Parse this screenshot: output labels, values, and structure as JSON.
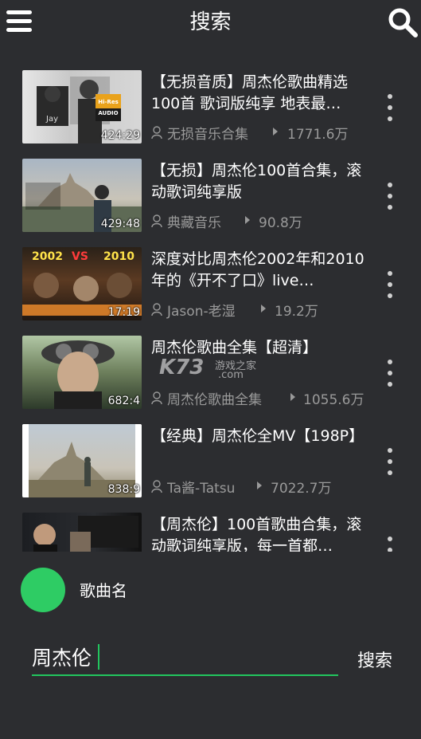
{
  "header": {
    "title": "搜索",
    "menu_icon": "hamburger-menu-icon",
    "search_icon": "search-icon"
  },
  "videos": [
    {
      "title": "【无损音质】周杰伦歌曲精选100首 歌词版纯享 地表最…",
      "uploader": "无损音乐合集",
      "views": "1771.6万",
      "duration": "424:29",
      "thumb_badge": "Hi-Res AUDIO",
      "thumb_text": "Jay"
    },
    {
      "title": "【无损】周杰伦100首合集，滚动歌词纯享版",
      "uploader": "典藏音乐",
      "views": "90.8万",
      "duration": "429:48"
    },
    {
      "title": "深度对比周杰伦2002年和2010年的《开不了口》live…",
      "uploader": "Jason-老湿",
      "views": "19.2万",
      "duration": "17:19",
      "thumb_text_a": "2002",
      "thumb_text_vs": "VS",
      "thumb_text_b": "2010"
    },
    {
      "title": "周杰伦歌曲全集【超清】",
      "uploader": "周杰伦歌曲全集",
      "views": "1055.6万",
      "duration": "682:4"
    },
    {
      "title": "【经典】周杰伦全MV【198P】",
      "uploader": "Ta酱-Tatsu",
      "views": "7022.7万",
      "duration": "838:9"
    },
    {
      "title": "【周杰伦】100首歌曲合集，滚动歌词纯享版，每一首都…",
      "uploader": "",
      "views": "",
      "duration": ""
    }
  ],
  "watermark": {
    "logo": "K73",
    "line1": "游戏之家",
    "line2": ".com"
  },
  "song_section": {
    "label": "歌曲名",
    "avatar_color": "#2ecc64"
  },
  "search": {
    "input_value": "周杰伦",
    "button_label": "搜索",
    "accent": "#22c55e"
  },
  "colors": {
    "background": "#2c2d30",
    "meta_text": "#9a9a9a"
  }
}
